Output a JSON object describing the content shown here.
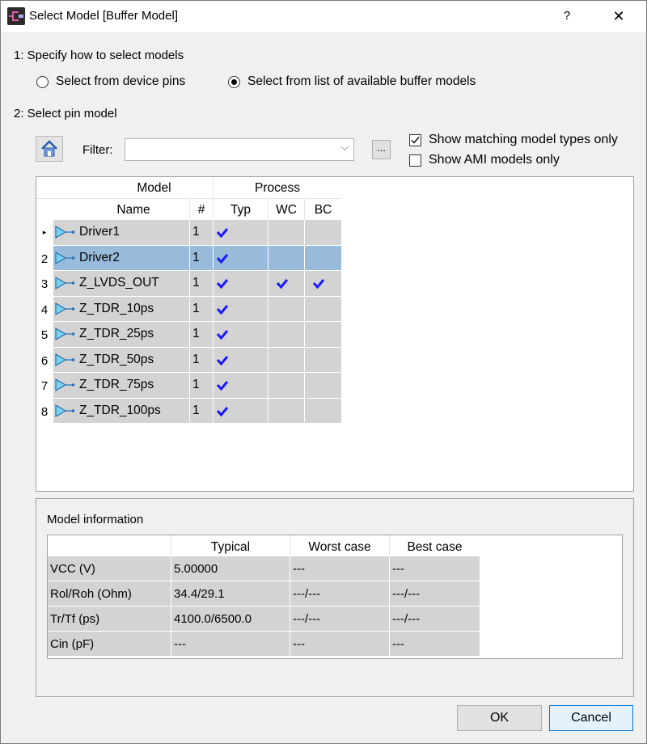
{
  "window": {
    "title": "Select Model [Buffer Model]",
    "help": "?",
    "close": "✕"
  },
  "step1": {
    "label": "1: Specify how to select models",
    "option_pins": "Select from device pins",
    "option_list": "Select from list of available buffer models",
    "selected": "list"
  },
  "step2": {
    "label": "2: Select pin model"
  },
  "filter": {
    "label": "Filter:",
    "value": "",
    "browse": "..."
  },
  "options": {
    "show_matching": {
      "label": "Show matching model types only",
      "checked": true
    },
    "show_ami": {
      "label": "Show AMI models only",
      "checked": false
    }
  },
  "grid": {
    "header_model": "Model",
    "header_process": "Process",
    "col_name": "Name",
    "col_count": "#",
    "col_typ": "Typ",
    "col_wc": "WC",
    "col_bc": "BC",
    "current_row_marker": "▸",
    "selected_row": 1,
    "rows": [
      {
        "num": "",
        "name": "Driver1",
        "count": "1",
        "typ": true,
        "wc": false,
        "bc": false
      },
      {
        "num": "2",
        "name": "Driver2",
        "count": "1",
        "typ": true,
        "wc": false,
        "bc": false
      },
      {
        "num": "3",
        "name": "Z_LVDS_OUT",
        "count": "1",
        "typ": true,
        "wc": true,
        "bc": true
      },
      {
        "num": "4",
        "name": "Z_TDR_10ps",
        "count": "1",
        "typ": true,
        "wc": false,
        "bc": false
      },
      {
        "num": "5",
        "name": "Z_TDR_25ps",
        "count": "1",
        "typ": true,
        "wc": false,
        "bc": false
      },
      {
        "num": "6",
        "name": "Z_TDR_50ps",
        "count": "1",
        "typ": true,
        "wc": false,
        "bc": false
      },
      {
        "num": "7",
        "name": "Z_TDR_75ps",
        "count": "1",
        "typ": true,
        "wc": false,
        "bc": false
      },
      {
        "num": "8",
        "name": "Z_TDR_100ps",
        "count": "1",
        "typ": true,
        "wc": false,
        "bc": false
      }
    ]
  },
  "info": {
    "title": "Model information",
    "headers": [
      "Typical",
      "Worst case",
      "Best case"
    ],
    "rows": [
      {
        "label": "VCC (V)",
        "typ": "5.00000",
        "wc": "---",
        "bc": "---"
      },
      {
        "label": "Rol/Roh (Ohm)",
        "typ": "34.4/29.1",
        "wc": "---/---",
        "bc": "---/---"
      },
      {
        "label": "Tr/Tf (ps)",
        "typ": "4100.0/6500.0",
        "wc": "---/---",
        "bc": "---/---"
      },
      {
        "label": "Cin (pF)",
        "typ": "---",
        "wc": "---",
        "bc": "---"
      }
    ]
  },
  "buttons": {
    "ok": "OK",
    "cancel": "Cancel"
  },
  "colors": {
    "check": "#1a1aff",
    "selected_row": "#99bbdb",
    "cell": "#d3d3d3"
  }
}
